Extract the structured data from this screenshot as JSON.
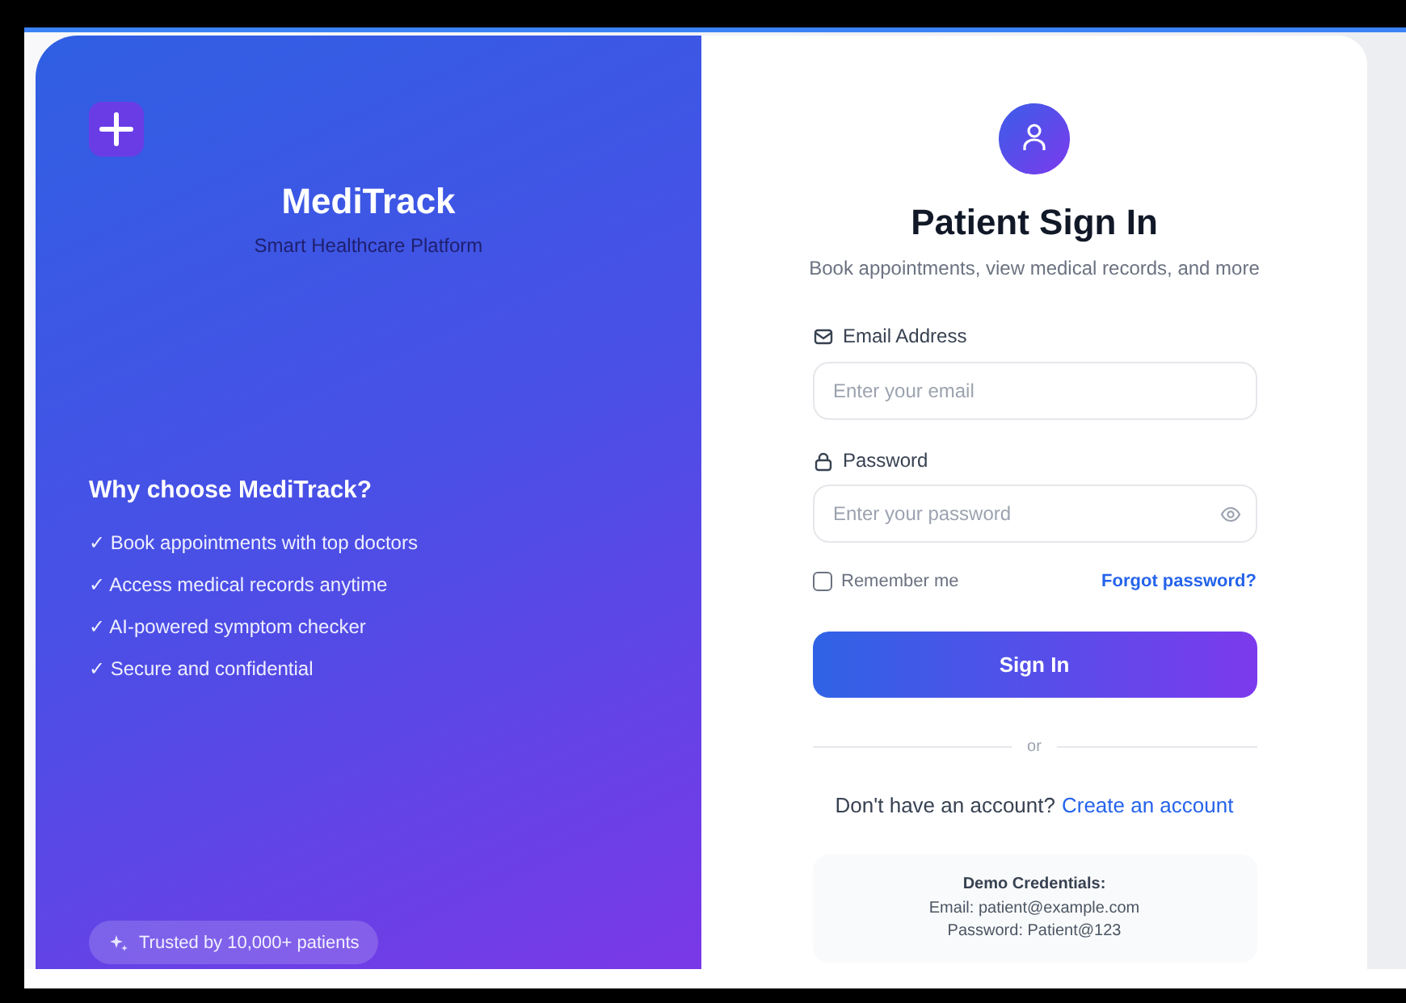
{
  "brand": {
    "name": "MediTrack",
    "tagline": "Smart Healthcare Platform",
    "features_title": "Why choose MediTrack?",
    "features": [
      "✓ Book appointments with top doctors",
      "✓ Access medical records anytime",
      "✓ AI-powered symptom checker",
      "✓ Secure and confidential"
    ],
    "badge": "Trusted by 10,000+ patients"
  },
  "form": {
    "title": "Patient Sign In",
    "subtitle": "Book appointments, view medical records, and more",
    "email": {
      "label": "Email Address",
      "placeholder": "Enter your email"
    },
    "password": {
      "label": "Password",
      "placeholder": "Enter your password"
    },
    "remember": {
      "label": "Remember me",
      "checked": false
    },
    "forgot_link": "Forgot password?",
    "submit": "Sign In",
    "divider": "or",
    "signup": {
      "prompt": "Don't have an account?",
      "link": "Create an account"
    },
    "demo": {
      "title": "Demo Credentials:",
      "lines": [
        "Email: patient@example.com",
        "Password: Patient@123"
      ]
    }
  }
}
